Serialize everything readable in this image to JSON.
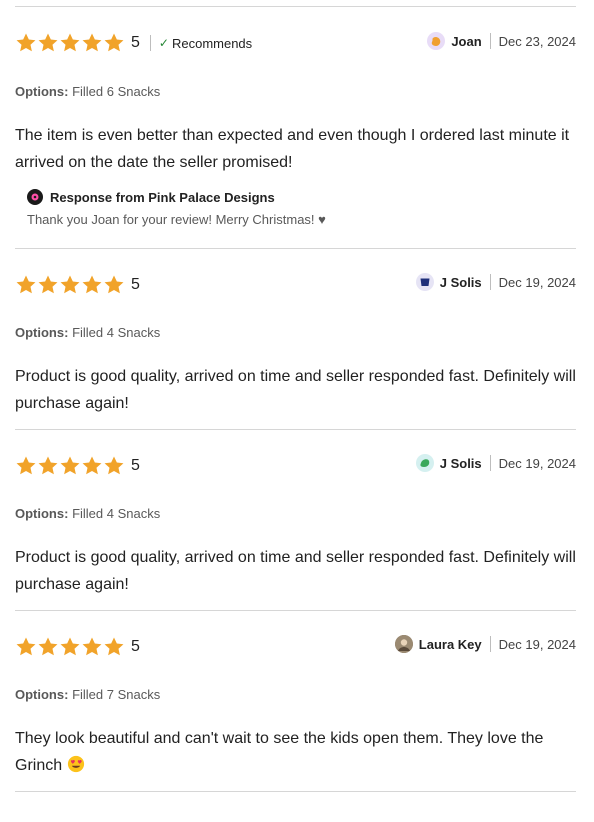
{
  "colors": {
    "star": "#f1a32a",
    "check": "#258635",
    "rule": "#d6d6d6"
  },
  "reviews": [
    {
      "rating": "5",
      "stars_filled": 5,
      "recommends": "Recommends",
      "reviewer": "Joan",
      "date": "Dec 23, 2024",
      "options_label": "Options:",
      "options_value": "Filled 6 Snacks",
      "text": "The item is even better than expected and even though I ordered last minute it arrived on the date the seller promised!",
      "response": {
        "title": "Response from Pink Palace Designs",
        "text": "Thank you Joan for your review! Merry Christmas! ♥"
      }
    },
    {
      "rating": "5",
      "stars_filled": 5,
      "reviewer": "J Solis",
      "date": "Dec 19, 2024",
      "options_label": "Options:",
      "options_value": "Filled 4 Snacks",
      "text": "Product is good quality, arrived on time and seller responded fast. Definitely will purchase again!"
    },
    {
      "rating": "5",
      "stars_filled": 5,
      "reviewer": "J Solis",
      "date": "Dec 19, 2024",
      "options_label": "Options:",
      "options_value": "Filled 4 Snacks",
      "text": "Product is good quality, arrived on time and seller responded fast. Definitely will purchase again!"
    },
    {
      "rating": "5",
      "stars_filled": 5,
      "reviewer": "Laura Key",
      "date": "Dec 19, 2024",
      "options_label": "Options:",
      "options_value": "Filled 7 Snacks",
      "text": "They look beautiful and can't wait to see the kids open them. They love the Grinch",
      "emoji": "heart-eyes-emoji"
    }
  ]
}
